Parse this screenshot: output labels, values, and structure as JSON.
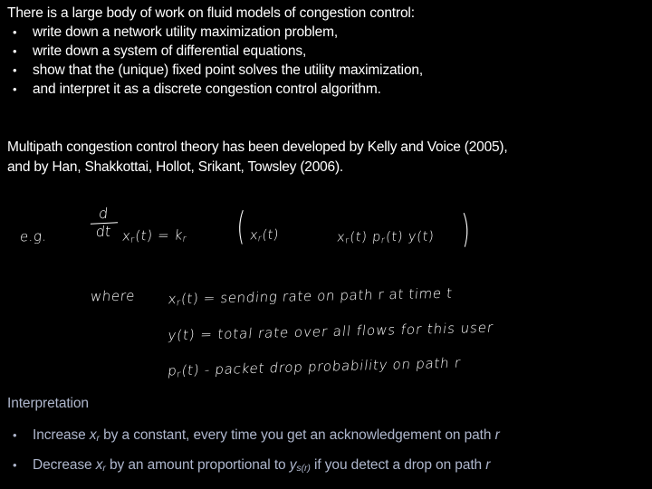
{
  "slide": {
    "background_color": "#000000",
    "body_text_color": "#ffffff",
    "interpretation_text_color": "#aeb6cc",
    "ink_color": "#ffffff"
  },
  "intro": {
    "lead": "There is a large body of work on fluid models of congestion control:",
    "bullet_glyph": "•",
    "items": [
      "write down a network utility maximization problem,",
      "write down a system of differential equations,",
      "show that the (unique) fixed point solves the utility maximization,",
      "and interpret it as a discrete congestion control algorithm."
    ]
  },
  "citation": {
    "line1": "Multipath congestion control theory has been developed by Kelly and Voice (2005),",
    "line2": "and by Han, Shakkottai, Hollot, Srikant, Towsley (2006)."
  },
  "handwriting": {
    "eg_label": "e.g.",
    "fraction_numerator": "d",
    "fraction_denominator": "dt",
    "equation_lhs": "x",
    "equation_lhs_sub": "r",
    "equation_lhs_arg": "(t)  =   k",
    "equation_k_sub": "r",
    "paren_open": "(",
    "paren_close": ")",
    "inner_term_a": "x",
    "inner_term_a_sub": "r",
    "inner_term_a_arg": "(t)",
    "inner_term_b": "x",
    "inner_term_b_sub": "r",
    "inner_term_b_arg": "(t)  p",
    "inner_term_b_sub2": "r",
    "inner_term_b_arg2": "(t)  y(t)",
    "where_label": "where",
    "def1_lead": "x",
    "def1_sub": "r",
    "def1_text": "(t)  =   sending rate on path r  at time t",
    "def2_lead": "y",
    "def2_text": "(t)  =  total  rate  over  all  flows  for this  user",
    "def3_lead": "p",
    "def3_sub": "r",
    "def3_text": "(t)  -  packet  drop probability  on path   r"
  },
  "interpretation": {
    "heading": "Interpretation",
    "bullet_glyph": "•",
    "items": [
      {
        "prefix": "Increase ",
        "var": "x",
        "var_sub": "r",
        "suffix": " by a constant, every time you get an acknowledgement on path ",
        "trailing_var": "r"
      },
      {
        "prefix": "Decrease ",
        "var": "x",
        "var_sub": "r",
        "suffix": " by an amount proportional to ",
        "var2": "y",
        "var2_sub": "s(r)",
        "suffix2": " if you detect a drop on path ",
        "trailing_var": "r"
      }
    ]
  }
}
